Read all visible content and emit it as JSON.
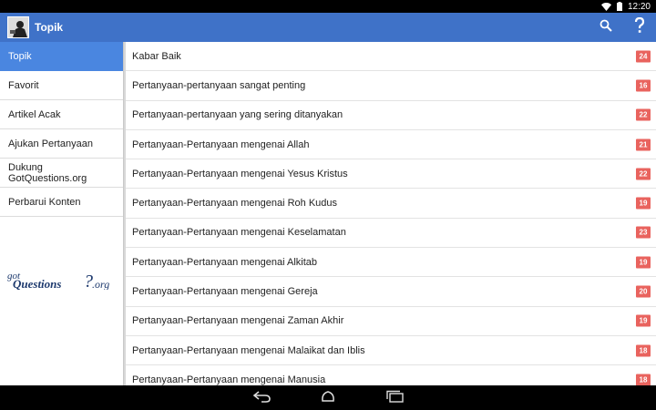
{
  "status_bar": {
    "time": "12:20"
  },
  "app_bar": {
    "title": "Topik",
    "search_label": "search-icon",
    "help_label": "help-icon"
  },
  "sidebar": {
    "items": [
      {
        "label": "Topik",
        "active": true
      },
      {
        "label": "Favorit",
        "active": false
      },
      {
        "label": "Artikel Acak",
        "active": false
      },
      {
        "label": "Ajukan Pertanyaan",
        "active": false
      },
      {
        "label": "Dukung GotQuestions.org",
        "active": false
      },
      {
        "label": "Perbarui Konten",
        "active": false
      }
    ],
    "logo_part1": "got",
    "logo_part2": "Questions",
    "logo_part3": "?",
    "logo_part4": ".org"
  },
  "topics": [
    {
      "label": "Kabar Baik",
      "count": "24"
    },
    {
      "label": "Pertanyaan-pertanyaan sangat penting",
      "count": "16"
    },
    {
      "label": "Pertanyaan-pertanyaan yang sering ditanyakan",
      "count": "22"
    },
    {
      "label": "Pertanyaan-Pertanyaan mengenai Allah",
      "count": "21"
    },
    {
      "label": "Pertanyaan-Pertanyaan mengenai Yesus Kristus",
      "count": "22"
    },
    {
      "label": "Pertanyaan-Pertanyaan mengenai Roh Kudus",
      "count": "19"
    },
    {
      "label": "Pertanyaan-Pertanyaan mengenai Keselamatan",
      "count": "23"
    },
    {
      "label": "Pertanyaan-Pertanyaan mengenai Alkitab",
      "count": "19"
    },
    {
      "label": "Pertanyaan-Pertanyaan mengenai Gereja",
      "count": "20"
    },
    {
      "label": "Pertanyaan-Pertanyaan mengenai Zaman Akhir",
      "count": "19"
    },
    {
      "label": "Pertanyaan-Pertanyaan mengenai Malaikat dan Iblis",
      "count": "18"
    },
    {
      "label": "Pertanyaan-Pertanyaan mengenai Manusia",
      "count": "18"
    }
  ],
  "colors": {
    "accent": "#3f72c8",
    "active": "#4a86e0",
    "badge": "#e9635e"
  },
  "nav_bar": {
    "back": "back-icon",
    "home": "home-icon",
    "recents": "recents-icon"
  }
}
